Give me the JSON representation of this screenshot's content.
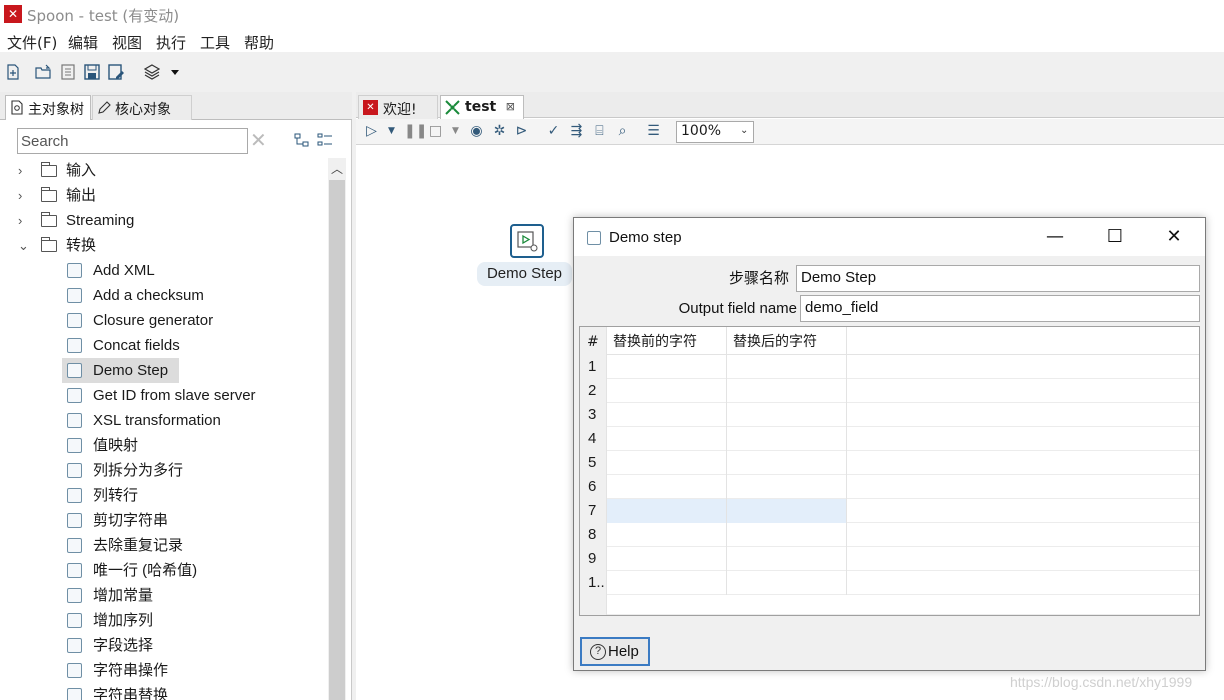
{
  "window": {
    "title": "Spoon - test (有变动)",
    "app_icon": "spoon-logo-icon"
  },
  "menu": [
    "文件(F)",
    "编辑",
    "视图",
    "执行",
    "工具",
    "帮助"
  ],
  "toolbar": {
    "icons": [
      "new-file-icon",
      "open-folder-icon",
      "explore-repository-icon",
      "save-icon",
      "save-as-icon",
      "layers-icon",
      "dropdown-arrow-icon"
    ]
  },
  "left_panel": {
    "tabs": [
      "主对象树",
      "核心对象"
    ],
    "search": {
      "placeholder": "Search",
      "value": ""
    },
    "tree": [
      {
        "label": "输入",
        "type": "folder",
        "expanded": false
      },
      {
        "label": "输出",
        "type": "folder",
        "expanded": false
      },
      {
        "label": "Streaming",
        "type": "folder",
        "expanded": false
      },
      {
        "label": "转换",
        "type": "folder",
        "expanded": true
      },
      {
        "label": "Add XML",
        "type": "step"
      },
      {
        "label": "Add a checksum",
        "type": "step"
      },
      {
        "label": "Closure generator",
        "type": "step"
      },
      {
        "label": "Concat fields",
        "type": "step"
      },
      {
        "label": "Demo Step",
        "type": "step",
        "selected": true
      },
      {
        "label": "Get ID from slave server",
        "type": "step"
      },
      {
        "label": "XSL transformation",
        "type": "step"
      },
      {
        "label": "值映射",
        "type": "step"
      },
      {
        "label": "列拆分为多行",
        "type": "step"
      },
      {
        "label": "列转行",
        "type": "step"
      },
      {
        "label": "剪切字符串",
        "type": "step"
      },
      {
        "label": "去除重复记录",
        "type": "step"
      },
      {
        "label": "唯一行 (哈希值)",
        "type": "step"
      },
      {
        "label": "增加常量",
        "type": "step"
      },
      {
        "label": "增加序列",
        "type": "step"
      },
      {
        "label": "字段选择",
        "type": "step"
      },
      {
        "label": "字符串操作",
        "type": "step"
      },
      {
        "label": "字符串替换",
        "type": "step"
      }
    ]
  },
  "editor": {
    "tabs": [
      {
        "label": "欢迎!",
        "closable": false
      },
      {
        "label": "test",
        "closable": true,
        "active": true
      }
    ],
    "zoom": "100%",
    "canvas_step": {
      "label": "Demo Step"
    }
  },
  "dialog": {
    "title": "Demo step",
    "controls": [
      "minimize",
      "maximize",
      "close"
    ],
    "fields": [
      {
        "label": "步骤名称",
        "value": "Demo Step"
      },
      {
        "label": "Output field name",
        "value": "demo_field"
      }
    ],
    "grid": {
      "columns": [
        "#",
        "替换前的字符",
        "替换后的字符"
      ],
      "rows": [
        "1",
        "2",
        "3",
        "4",
        "5",
        "6",
        "7",
        "8",
        "9",
        "1.."
      ],
      "selected_row": 7
    },
    "help_label": "Help"
  },
  "watermark": "https://blog.csdn.net/xhy1999",
  "colors": {
    "accent": "#3b7bc3",
    "selection": "#e3eefa",
    "brand": "#c8171d"
  }
}
